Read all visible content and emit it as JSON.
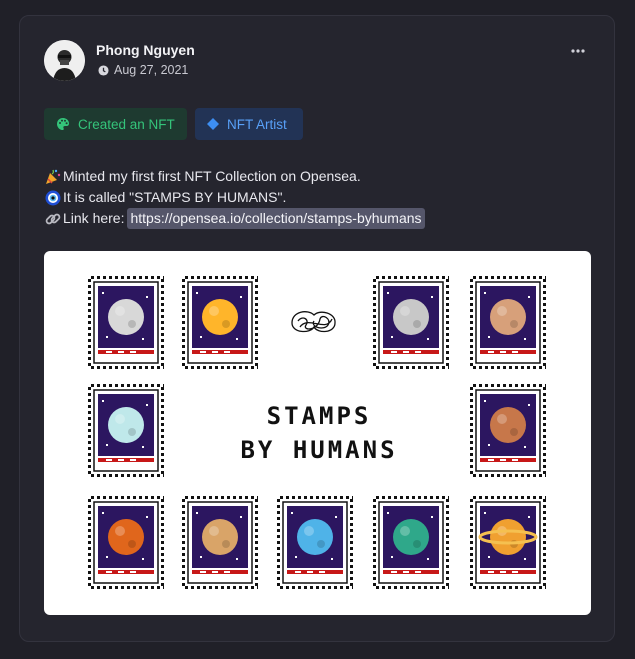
{
  "post": {
    "author": "Phong Nguyen",
    "date": "Aug 27, 2021",
    "tags": [
      {
        "label": "Created an NFT",
        "icon": "palette-icon",
        "color": "#34c47a"
      },
      {
        "label": "NFT Artist",
        "icon": "diamond-icon",
        "color": "#58a0f8"
      }
    ],
    "lines": [
      {
        "emoji": "party-popper-icon",
        "text": "Minted my first first NFT Collection on Opensea."
      },
      {
        "emoji": "nazar-amulet-icon",
        "text": "It is called \"STAMPS BY HUMANS\"."
      },
      {
        "emoji": "link-icon",
        "text": "Link here:",
        "link": "https://opensea.io/collection/stamps-byhumans"
      }
    ],
    "image": {
      "title_line1": "STAMPS",
      "title_line2": "BY HUMANS",
      "planet_colors": [
        "#d8d8d8",
        "#ffb52a",
        "#c8c8c8",
        "#d7a07a",
        "#bfe8ea",
        "#c7774a",
        "#e0661c",
        "#d9a468",
        "#4fb3e8",
        "#2fa88a",
        "#f0a030"
      ]
    }
  }
}
